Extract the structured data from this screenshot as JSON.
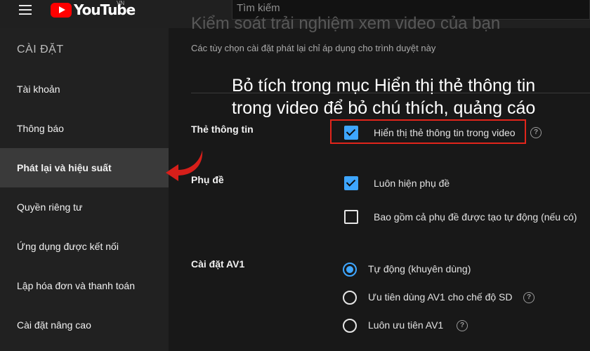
{
  "header": {
    "logo_text": "YouTube",
    "region": "VN",
    "search_placeholder": "Tìm kiếm"
  },
  "sidebar": {
    "title": "CÀI ĐẶT",
    "items": [
      {
        "label": "Tài khoản"
      },
      {
        "label": "Thông báo"
      },
      {
        "label": "Phát lại và hiệu suất",
        "active": true
      },
      {
        "label": "Quyền riêng tư"
      },
      {
        "label": "Ứng dụng được kết nối"
      },
      {
        "label": "Lập hóa đơn và thanh toán"
      },
      {
        "label": "Cài đặt nâng cao"
      }
    ]
  },
  "main": {
    "title": "Kiểm soát trải nghiệm xem video của bạn",
    "description": "Các tùy chọn cài đặt phát lại chỉ áp dụng cho trình duyệt này",
    "annotation_line1": "Bỏ tích trong mục Hiển thị thẻ thông tin",
    "annotation_line2": "trong video để bỏ chú thích, quảng cáo",
    "sections": {
      "info_cards": {
        "label": "Thẻ thông tin",
        "option": "Hiển thị thẻ thông tin trong video",
        "checked": true
      },
      "subtitles": {
        "label": "Phụ đề",
        "option1": "Luôn hiện phụ đề",
        "option1_checked": true,
        "option2": "Bao gồm cả phụ đề được tạo tự động (nếu có)",
        "option2_checked": false
      },
      "av1": {
        "label": "Cài đặt AV1",
        "options": [
          "Tự động (khuyên dùng)",
          "Ưu tiên dùng AV1 cho chế độ SD",
          "Luôn ưu tiên AV1"
        ],
        "selected": 0
      }
    }
  },
  "colors": {
    "accent": "#3ea6ff",
    "highlight_border": "#e1251b",
    "brand_red": "#ff0000"
  },
  "icons": {
    "menu": "hamburger-icon",
    "help": "question-circle-icon",
    "pointer": "curved-arrow-icon"
  }
}
